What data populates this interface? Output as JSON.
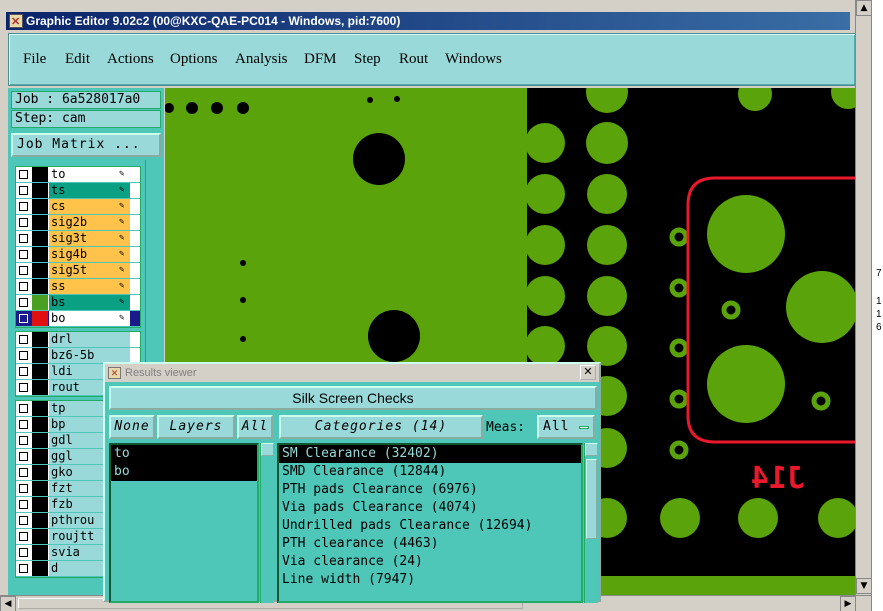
{
  "window": {
    "title": "Graphic Editor 9.02c2 (00@KXC-QAE-PC014 - Windows, pid:7600)"
  },
  "menu": [
    "File",
    "Edit",
    "Actions",
    "Options",
    "Analysis",
    "DFM",
    "Step",
    "Rout",
    "Windows"
  ],
  "left_panel": {
    "job_label": "Job : 6a528017a0",
    "step_label": "Step: cam",
    "job_matrix_button": "Job Matrix ...",
    "board_layers": [
      {
        "name": "to",
        "color": "#ffffff",
        "swatch": "#000000",
        "checked": false,
        "pen": true
      },
      {
        "name": "ts",
        "color": "#0aa084",
        "swatch": "#000000",
        "checked": false,
        "pen": true
      },
      {
        "name": "cs",
        "color": "#ffc24a",
        "swatch": "#000000",
        "checked": false,
        "pen": true
      },
      {
        "name": "sig2b",
        "color": "#ffc24a",
        "swatch": "#000000",
        "checked": false,
        "pen": true
      },
      {
        "name": "sig3t",
        "color": "#ffc24a",
        "swatch": "#000000",
        "checked": false,
        "pen": true
      },
      {
        "name": "sig4b",
        "color": "#ffc24a",
        "swatch": "#000000",
        "checked": false,
        "pen": true
      },
      {
        "name": "sig5t",
        "color": "#ffc24a",
        "swatch": "#000000",
        "checked": false,
        "pen": true
      },
      {
        "name": "ss",
        "color": "#ffc24a",
        "swatch": "#000000",
        "checked": false,
        "pen": true
      },
      {
        "name": "bs",
        "color": "#0aa084",
        "swatch": "#4aa020",
        "checked": false,
        "pen": true
      },
      {
        "name": "bo",
        "color": "#ffffff",
        "swatch": "#e01010",
        "checked": true,
        "pen": true,
        "selected": true
      }
    ],
    "drill_layers": [
      "drl",
      "bz6-5b",
      "ldi",
      "rout"
    ],
    "misc_layers": [
      "tp",
      "bp",
      "gdl",
      "ggl",
      "gko",
      "fzt",
      "fzb",
      "pthrou",
      "roujtt",
      "svia",
      "d"
    ]
  },
  "canvas": {
    "component_label": "J14",
    "colors": {
      "board": "#5aa30a",
      "background": "#000000",
      "outline": "#e8192c"
    }
  },
  "results_viewer": {
    "title": "Results viewer",
    "header": "Silk Screen Checks",
    "none_button": "None",
    "layers_button": "Layers",
    "all_button": "All",
    "categories_button": "Categories (14)",
    "meas_label": "Meas:",
    "meas_value": "All",
    "layers": [
      "to",
      "bo"
    ],
    "categories": [
      "SM Clearance (32402)",
      "SMD Clearance (12844)",
      "PTH pads Clearance (6976)",
      "Via pads Clearance (4074)",
      "Undrilled pads Clearance (12694)",
      "PTH clearance (4463)",
      "Via clearance (24)",
      "Line width (7947)"
    ]
  },
  "right_strip_digits": [
    "7",
    "1",
    "1",
    "6"
  ]
}
